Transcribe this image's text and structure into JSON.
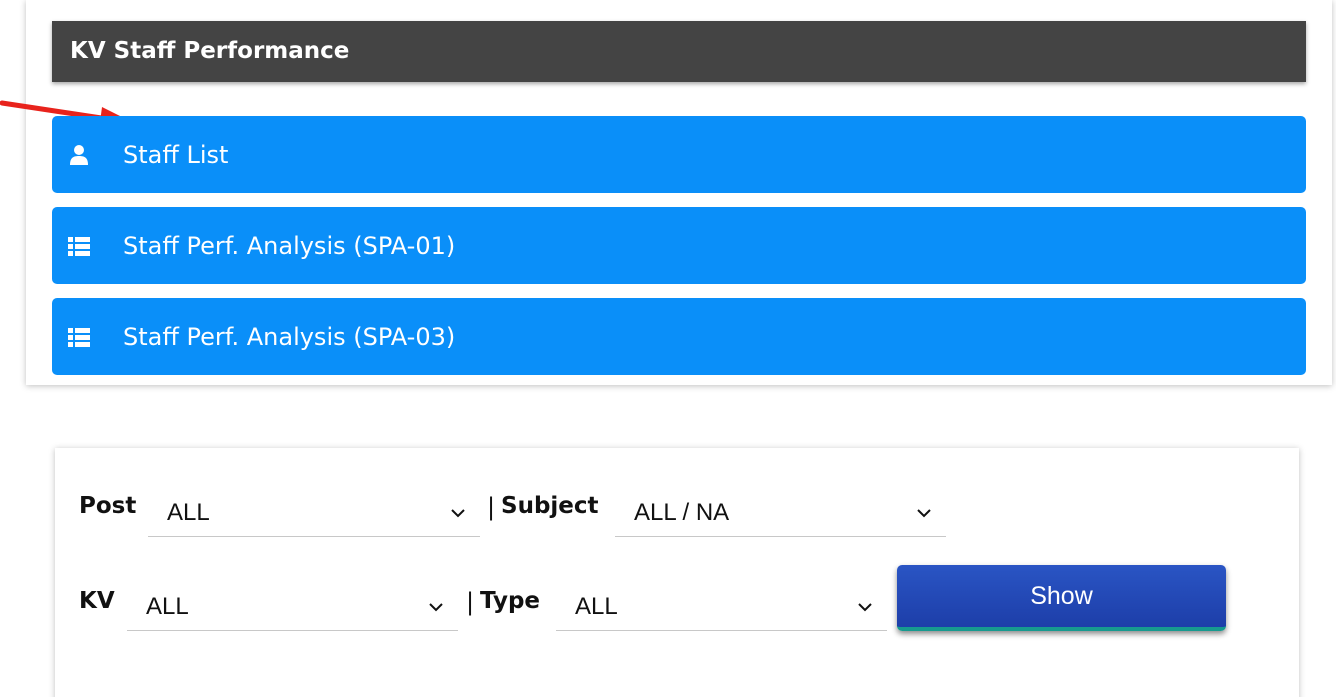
{
  "panel": {
    "title": "KV Staff Performance",
    "items": [
      {
        "label": "Staff List",
        "icon": "user-icon"
      },
      {
        "label": "Staff Perf. Analysis (SPA-01)",
        "icon": "list-icon"
      },
      {
        "label": "Staff Perf. Analysis (SPA-03)",
        "icon": "list-icon"
      }
    ]
  },
  "filters": {
    "post": {
      "label": "Post",
      "value": "ALL"
    },
    "subject": {
      "label": "Subject",
      "value": "ALL / NA"
    },
    "kv": {
      "label": "KV",
      "value": "ALL"
    },
    "type": {
      "label": "Type",
      "value": "ALL"
    },
    "separator": "|",
    "show_label": "Show"
  },
  "colors": {
    "header_bg": "#444444",
    "menu_bg": "#0a8ff9",
    "button_bg": "#1d3ea9",
    "annotation_arrow": "#e8231c"
  }
}
